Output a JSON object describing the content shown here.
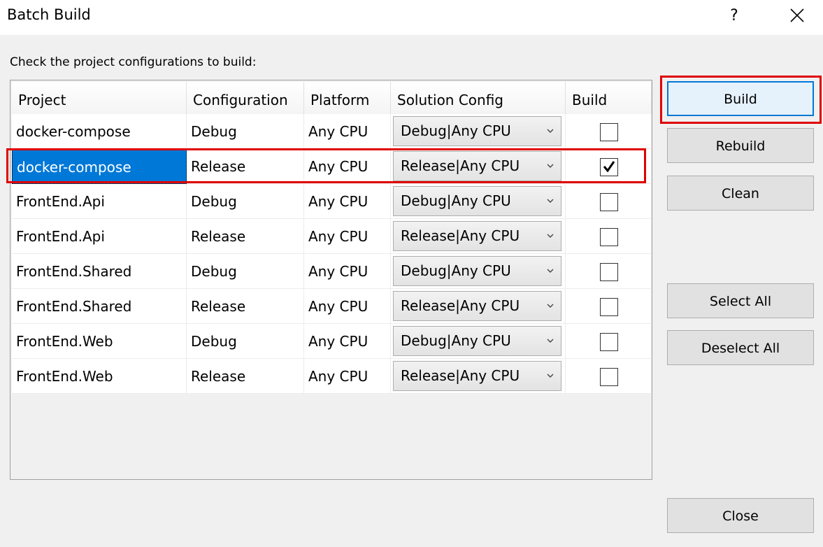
{
  "window": {
    "title": "Batch Build",
    "help_label": "?",
    "close_icon": "close-icon"
  },
  "instruction": "Check the project configurations to build:",
  "columns": [
    "Project",
    "Configuration",
    "Platform",
    "Solution Config",
    "Build"
  ],
  "rows": [
    {
      "project": "docker-compose",
      "configuration": "Debug",
      "platform": "Any CPU",
      "solution_config": "Debug|Any CPU",
      "build": false,
      "selected": false
    },
    {
      "project": "docker-compose",
      "configuration": "Release",
      "platform": "Any CPU",
      "solution_config": "Release|Any CPU",
      "build": true,
      "selected": true
    },
    {
      "project": "FrontEnd.Api",
      "configuration": "Debug",
      "platform": "Any CPU",
      "solution_config": "Debug|Any CPU",
      "build": false,
      "selected": false
    },
    {
      "project": "FrontEnd.Api",
      "configuration": "Release",
      "platform": "Any CPU",
      "solution_config": "Release|Any CPU",
      "build": false,
      "selected": false
    },
    {
      "project": "FrontEnd.Shared",
      "configuration": "Debug",
      "platform": "Any CPU",
      "solution_config": "Debug|Any CPU",
      "build": false,
      "selected": false
    },
    {
      "project": "FrontEnd.Shared",
      "configuration": "Release",
      "platform": "Any CPU",
      "solution_config": "Release|Any CPU",
      "build": false,
      "selected": false
    },
    {
      "project": "FrontEnd.Web",
      "configuration": "Debug",
      "platform": "Any CPU",
      "solution_config": "Debug|Any CPU",
      "build": false,
      "selected": false
    },
    {
      "project": "FrontEnd.Web",
      "configuration": "Release",
      "platform": "Any CPU",
      "solution_config": "Release|Any CPU",
      "build": false,
      "selected": false
    }
  ],
  "buttons": {
    "build": "Build",
    "rebuild": "Rebuild",
    "clean": "Clean",
    "select_all": "Select All",
    "deselect_all": "Deselect All",
    "close": "Close"
  },
  "colors": {
    "selection": "#0078d7",
    "highlight_annotation": "#e00000",
    "default_button_border": "#0078d7"
  }
}
